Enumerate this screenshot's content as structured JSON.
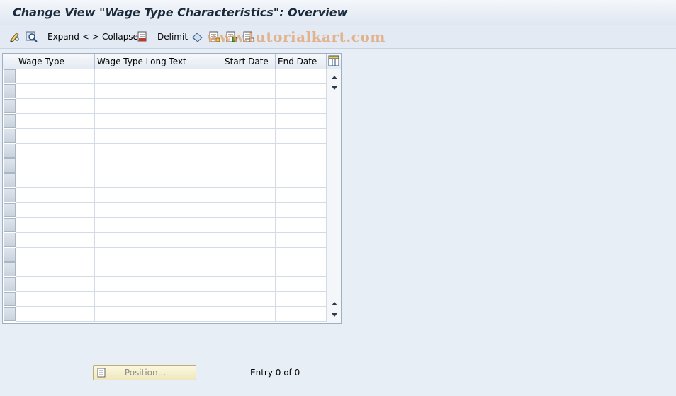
{
  "title": "Change View \"Wage Type Characteristics\": Overview",
  "toolbar": {
    "expand_collapse_label": "Expand <-> Collapse",
    "delimit_label": "Delimit"
  },
  "watermark": "www.tutorialkart.com",
  "table": {
    "columns": [
      "Wage Type",
      "Wage Type Long Text",
      "Start Date",
      "End Date"
    ],
    "rows": []
  },
  "footer": {
    "position_label": "Position...",
    "entry_text": "Entry 0 of 0"
  },
  "colors": {
    "background": "#e8eef5",
    "position_button": "#efe8bd",
    "watermark": "#e2a06e"
  }
}
